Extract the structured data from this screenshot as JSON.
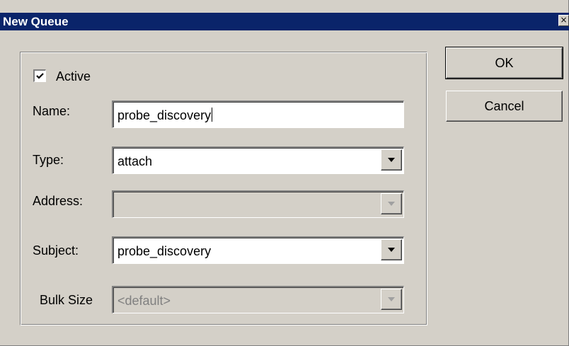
{
  "window": {
    "title": "New Queue",
    "close_glyph": "×"
  },
  "form": {
    "active": {
      "label": "Active",
      "checked": true
    },
    "name": {
      "label": "Name:",
      "value": "probe_discovery"
    },
    "type": {
      "label": "Type:",
      "value": "attach"
    },
    "address": {
      "label": "Address:",
      "value": "",
      "disabled": true
    },
    "subject": {
      "label": "Subject:",
      "value": "probe_discovery"
    },
    "bulk_size": {
      "label": "Bulk Size",
      "value": "<default>",
      "disabled": true
    }
  },
  "buttons": {
    "ok": "OK",
    "cancel": "Cancel"
  },
  "icons": {
    "checkmark": "checkmark-icon",
    "dropdown": "chevron-down-icon",
    "close": "close-icon"
  },
  "colors": {
    "titlebar": "#0a246a",
    "face": "#d4d0c8"
  }
}
